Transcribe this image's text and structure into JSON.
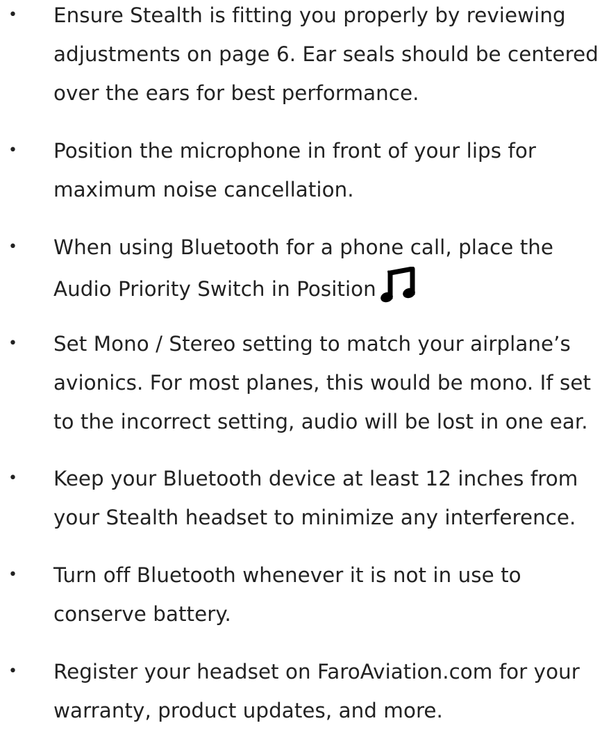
{
  "tips": [
    {
      "bullet": "•",
      "lines": [
        "Ensure Stealth is fitting you properly by reviewing",
        "adjustments on page 6. Ear seals should be centered",
        "over the ears for best performance."
      ]
    },
    {
      "bullet": "•",
      "lines": [
        "Position the microphone in front of your lips for",
        "maximum noise cancellation."
      ]
    },
    {
      "bullet": "•",
      "lines": [
        "When using Bluetooth for a phone call, place the",
        "Audio Priority Switch in Position"
      ],
      "icon": "music-note-icon"
    },
    {
      "bullet": "•",
      "lines": [
        "Set Mono / Stereo setting to match your airplane’s",
        "avionics. For most planes, this would be mono. If set",
        "to the incorrect setting, audio will be lost in one ear."
      ]
    },
    {
      "bullet": "•",
      "lines": [
        "Keep your Bluetooth device at least 12 inches from",
        "your Stealth headset to minimize any interference."
      ]
    },
    {
      "bullet": "•",
      "lines": [
        "Turn off Bluetooth whenever it is not in use to",
        "conserve battery."
      ]
    },
    {
      "bullet": "•",
      "lines": [
        "Register your headset on FaroAviation.com for your",
        "warranty, product updates, and more."
      ]
    }
  ],
  "colors": {
    "text": "#222222",
    "background": "#ffffff"
  }
}
